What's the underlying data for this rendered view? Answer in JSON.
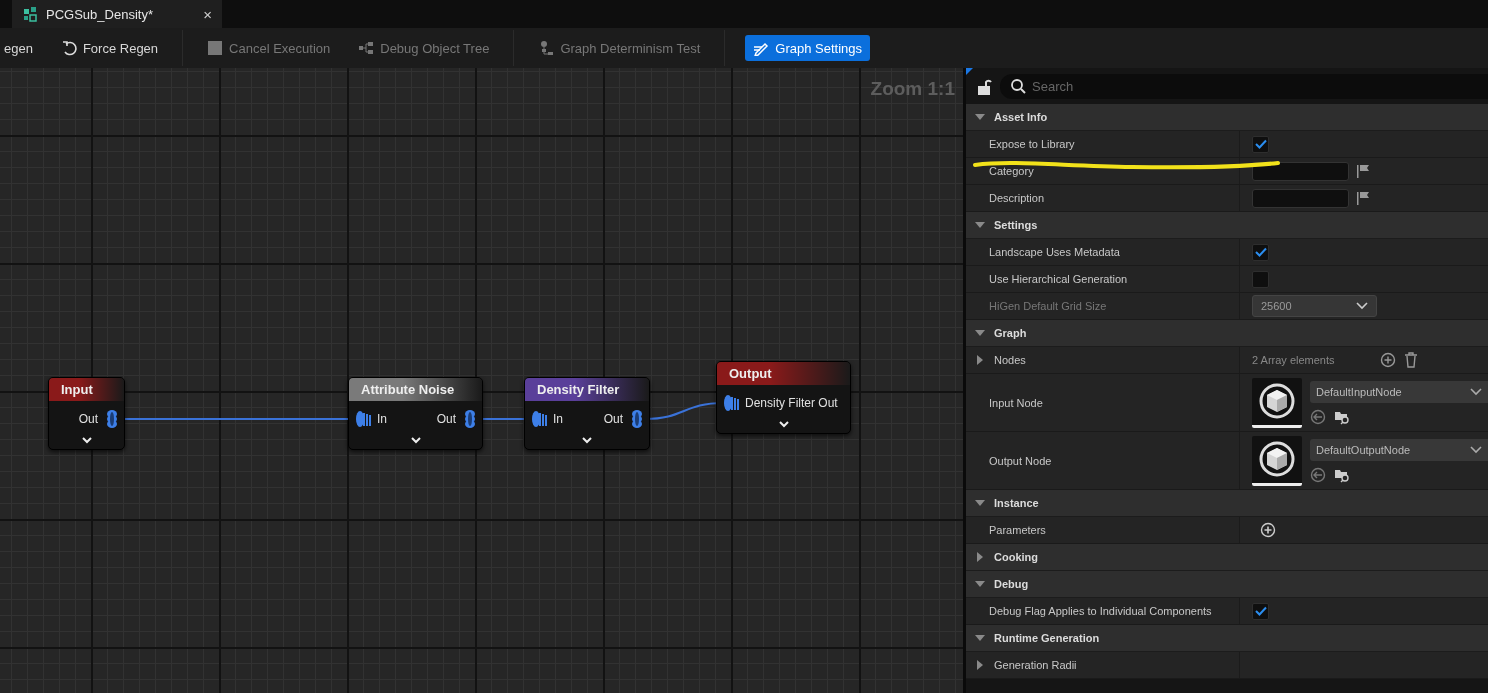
{
  "tab": {
    "title": "PCGSub_Density*",
    "close": "×"
  },
  "toolbar": [
    {
      "label": "egen",
      "kind": "none",
      "disabled": false,
      "selected": false
    },
    {
      "label": "Force Regen",
      "kind": "undo",
      "disabled": false,
      "selected": false
    },
    {
      "label": "Cancel Execution",
      "kind": "stop",
      "disabled": true,
      "selected": false
    },
    {
      "label": "Debug Object Tree",
      "kind": "tree",
      "disabled": true,
      "selected": false
    },
    {
      "label": "Graph Determinism Test",
      "kind": "determinism",
      "disabled": true,
      "selected": false
    },
    {
      "label": "Graph Settings",
      "kind": "settings",
      "disabled": false,
      "selected": true
    }
  ],
  "graph": {
    "zoom": "Zoom 1:1",
    "nodes": [
      {
        "title": "Input",
        "color": "#8a1a1a",
        "outputs": [
          {
            "label": "Out",
            "connected": true
          }
        ]
      },
      {
        "title": "Attribute Noise",
        "color": "#7a7a7a",
        "inputs": [
          {
            "label": "In",
            "connected": true
          }
        ],
        "outputs": [
          {
            "label": "Out",
            "connected": true
          }
        ]
      },
      {
        "title": "Density Filter",
        "color": "#5a3f9a",
        "inputs": [
          {
            "label": "In",
            "connected": true
          }
        ],
        "outputs": [
          {
            "label": "Out",
            "connected": true
          }
        ]
      },
      {
        "title": "Output",
        "color": "#8a1a1a",
        "inputs": [
          {
            "label": "Density Filter Out",
            "connected": true
          }
        ]
      }
    ]
  },
  "details": {
    "search": {
      "placeholder": "Search"
    },
    "annotation": {
      "kind": "underline",
      "color": "#f2e21a"
    },
    "sections": [
      {
        "title": "Asset Info",
        "expanded": true,
        "rows": [
          {
            "kind": "checkbox",
            "label": "Expose to Library",
            "checked": true
          },
          {
            "kind": "text",
            "label": "Category"
          },
          {
            "kind": "text",
            "label": "Description"
          }
        ]
      },
      {
        "title": "Settings",
        "expanded": true,
        "rows": [
          {
            "kind": "checkbox",
            "label": "Landscape Uses Metadata",
            "checked": true
          },
          {
            "kind": "checkbox",
            "label": "Use Hierarchical Generation",
            "checked": false
          },
          {
            "kind": "dropdown",
            "label": "HiGen Default Grid Size",
            "value": "25600",
            "disabled": true
          }
        ]
      },
      {
        "title": "Graph",
        "expanded": true,
        "rows": [
          {
            "kind": "array",
            "label": "Nodes",
            "expanded": false,
            "summary": "2 Array elements"
          },
          {
            "kind": "asset",
            "label": "Input Node",
            "value": "DefaultInputNode"
          },
          {
            "kind": "asset",
            "label": "Output Node",
            "value": "DefaultOutputNode"
          }
        ]
      },
      {
        "title": "Instance",
        "expanded": true,
        "rows": [
          {
            "kind": "add",
            "label": "Parameters"
          }
        ]
      },
      {
        "title": "Cooking",
        "expanded": false
      },
      {
        "title": "Debug",
        "expanded": true,
        "rows": [
          {
            "kind": "checkbox",
            "label": "Debug Flag Applies to Individual Components",
            "checked": true
          }
        ]
      },
      {
        "title": "Runtime Generation",
        "expanded": true,
        "rows": [
          {
            "kind": "group",
            "label": "Generation Radii",
            "expanded": false
          }
        ]
      }
    ]
  }
}
